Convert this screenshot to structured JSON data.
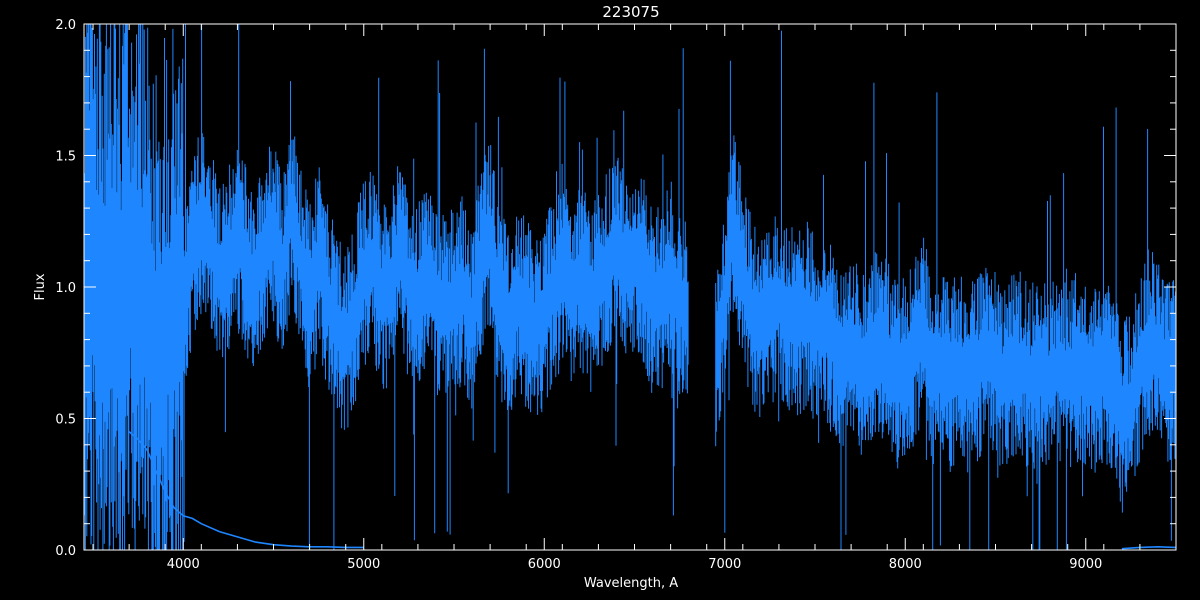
{
  "chart_data": {
    "type": "line",
    "title": "223075",
    "xlabel": "Wavelength, A",
    "ylabel": "Flux",
    "xlim": [
      3450,
      9500
    ],
    "ylim": [
      0.0,
      2.0
    ],
    "x_ticks": [
      4000,
      5000,
      6000,
      7000,
      8000,
      9000
    ],
    "x_tick_labels": [
      "4000",
      "5000",
      "6000",
      "7000",
      "8000",
      "9000"
    ],
    "y_ticks": [
      0.0,
      0.5,
      1.0,
      1.5,
      2.0
    ],
    "y_tick_labels": [
      "0.0",
      "0.5",
      "1.0",
      "1.5",
      "2.0"
    ],
    "grid": false,
    "background": "#000000",
    "axis_color": "#ffffff",
    "series": [
      {
        "color": "#1e86ff",
        "x": [
          3450,
          3500,
          3550,
          3600,
          3650,
          3700,
          3750,
          3800,
          3850,
          3900,
          3950,
          4000,
          4050,
          4100,
          4150,
          4200,
          4250,
          4300,
          4350,
          4400,
          4450,
          4500,
          4550,
          4600,
          4650,
          4700,
          4750,
          4800,
          4850,
          4900,
          4950,
          5000,
          5050,
          5100,
          5150,
          5200,
          5250,
          5300,
          5350,
          5400,
          5450,
          5500,
          5550,
          5600,
          5650,
          5700,
          5750,
          5800,
          5850,
          5900,
          5950,
          6000,
          6050,
          6100,
          6150,
          6200,
          6250,
          6300,
          6350,
          6400,
          6450,
          6500,
          6550,
          6600,
          6650,
          6700,
          6750,
          6800,
          6950,
          7000,
          7050,
          7100,
          7150,
          7200,
          7250,
          7300,
          7350,
          7400,
          7450,
          7500,
          7550,
          7600,
          7650,
          7700,
          7750,
          7800,
          7850,
          7900,
          7950,
          8000,
          8050,
          8100,
          8150,
          8200,
          8250,
          8300,
          8350,
          8400,
          8450,
          8500,
          8550,
          8600,
          8650,
          8700,
          8750,
          8800,
          8850,
          8900,
          8950,
          9000,
          9050,
          9100,
          9150,
          9200,
          9250,
          9300,
          9350,
          9400,
          9450,
          9500
        ],
        "y": [
          1.0,
          1.1,
          1.05,
          1.0,
          0.95,
          1.1,
          1.05,
          0.9,
          0.75,
          0.85,
          0.9,
          0.95,
          1.15,
          1.25,
          1.2,
          1.05,
          1.1,
          1.2,
          1.1,
          1.0,
          1.15,
          1.2,
          1.05,
          1.3,
          1.1,
          0.95,
          1.1,
          0.95,
          0.85,
          0.8,
          0.9,
          1.05,
          1.1,
          0.95,
          1.0,
          1.15,
          1.0,
          0.95,
          1.05,
          0.95,
          0.9,
          0.95,
          1.0,
          0.85,
          1.1,
          1.2,
          0.95,
          0.85,
          0.95,
          0.9,
          0.85,
          0.9,
          1.0,
          1.05,
          1.0,
          1.05,
          0.95,
          1.0,
          1.1,
          1.15,
          1.1,
          1.1,
          1.05,
          0.95,
          0.95,
          1.05,
          0.95,
          0.85,
          0.75,
          0.95,
          1.25,
          1.05,
          0.9,
          0.85,
          0.9,
          0.95,
          0.9,
          0.85,
          0.9,
          0.85,
          0.85,
          0.8,
          0.75,
          0.8,
          0.7,
          0.75,
          0.8,
          0.75,
          0.65,
          0.7,
          0.75,
          0.85,
          0.65,
          0.7,
          0.65,
          0.7,
          0.65,
          0.7,
          0.75,
          0.7,
          0.65,
          0.7,
          0.7,
          0.65,
          0.7,
          0.65,
          0.7,
          0.65,
          0.7,
          0.65,
          0.65,
          0.7,
          0.65,
          0.5,
          0.55,
          0.7,
          0.8,
          0.75,
          0.65,
          0.7
        ]
      },
      {
        "color": "#1e86ff",
        "x": [
          3700,
          3750,
          3800,
          3850,
          3900,
          3950,
          4000,
          4050,
          4100,
          4200,
          4300,
          4400,
          4500,
          4600,
          4700,
          4800,
          4900,
          5000,
          5200,
          5500,
          6000,
          6500,
          7000,
          7500,
          8000,
          8500,
          9000,
          9200,
          9300,
          9400,
          9500
        ],
        "y": [
          0.45,
          0.42,
          0.38,
          0.3,
          0.22,
          0.16,
          0.13,
          0.12,
          0.1,
          0.07,
          0.05,
          0.03,
          0.02,
          0.015,
          0.012,
          0.012,
          0.01,
          0.01,
          0.01,
          0.008,
          0.005,
          0.004,
          0.004,
          0.004,
          0.004,
          0.004,
          0.004,
          0.005,
          0.01,
          0.012,
          0.01
        ]
      }
    ]
  }
}
